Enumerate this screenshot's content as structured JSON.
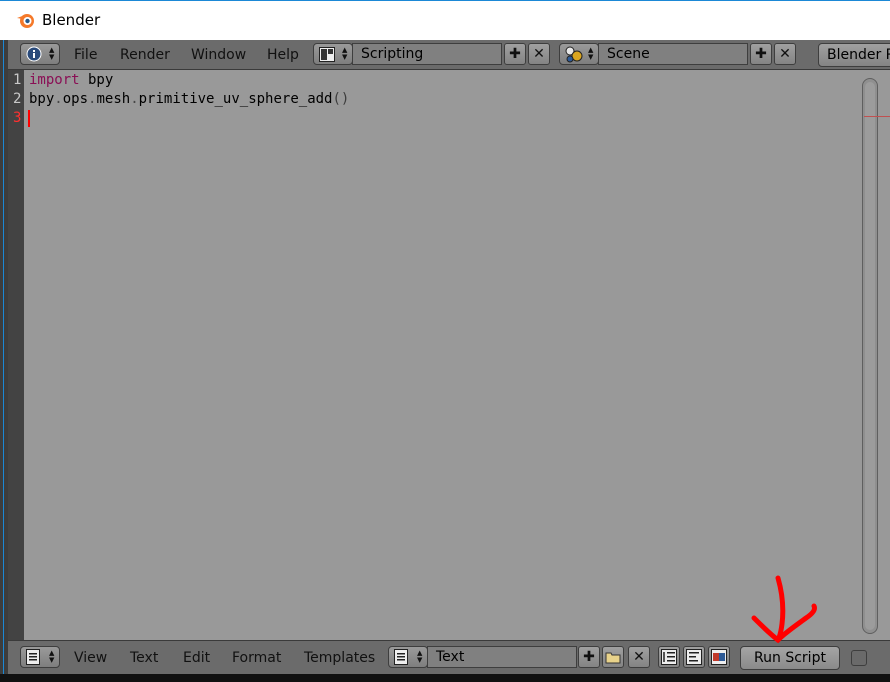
{
  "window": {
    "title": "Blender"
  },
  "header": {
    "menus": [
      "File",
      "Render",
      "Window",
      "Help"
    ],
    "screen_layout": "Scripting",
    "scene": "Scene",
    "render_engine": "Blender R"
  },
  "editor": {
    "line_numbers": [
      "1",
      "2",
      "3"
    ],
    "lines": {
      "l1_kw": "import",
      "l1_rest": " bpy",
      "l2": {
        "p1": "bpy",
        "p2": "ops",
        "p3": "mesh",
        "p4": "primitive_uv_sphere_add",
        "dot": ".",
        "parens": "()"
      }
    }
  },
  "footer": {
    "menus": [
      "View",
      "Text",
      "Edit",
      "Format",
      "Templates"
    ],
    "text_block": "Text",
    "run_script_label": "Run Script"
  },
  "colors": {
    "keyword": "#8a0f55",
    "editor_bg": "#999999",
    "annotation": "#ff0000"
  }
}
